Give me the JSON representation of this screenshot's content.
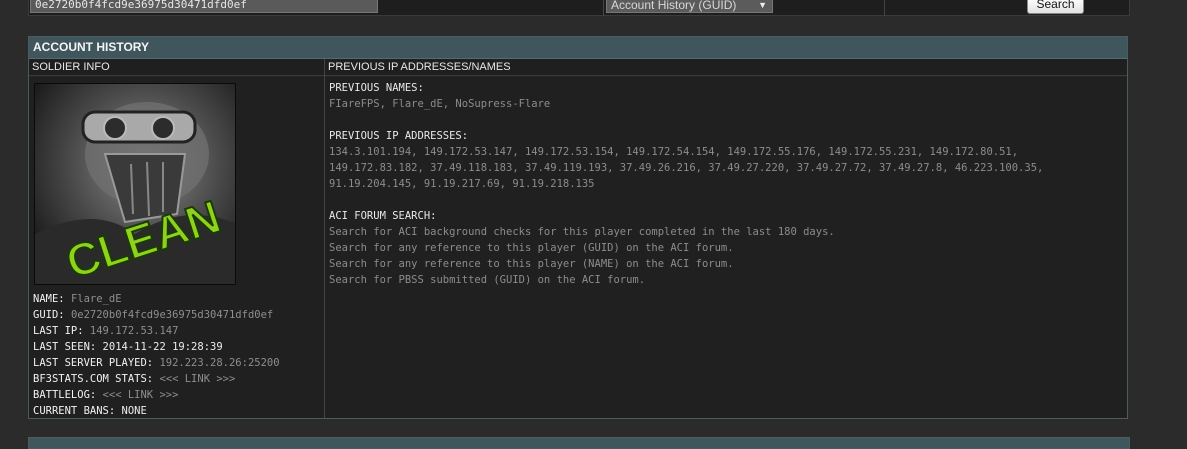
{
  "search": {
    "query_value": "0e2720b0f4fcd9e36975d30471dfd0ef",
    "type_selected": "Account History (GUID)",
    "button_label": "Search"
  },
  "panel": {
    "title": "ACCOUNT HISTORY",
    "left_header": "SOLDIER INFO",
    "right_header": "PREVIOUS IP ADDRESSES/NAMES"
  },
  "avatar": {
    "text": "CLEAN",
    "accent_color": "#8fd11c"
  },
  "soldier": {
    "name_label": "NAME:",
    "name": "Flare_dE",
    "guid_label": "GUID:",
    "guid": "0e2720b0f4fcd9e36975d30471dfd0ef",
    "last_ip_label": "LAST IP:",
    "last_ip": "149.172.53.147",
    "last_seen_label": "LAST SEEN:",
    "last_seen": "2014-11-22 19:28:39",
    "last_server_label": "LAST SERVER PLAYED:",
    "last_server": "192.223.28.26:25200",
    "bf3stats_label": "BF3STATS.COM STATS:",
    "bf3stats_link": "<<< LINK >>>",
    "battlelog_label": "BATTLELOG:",
    "battlelog_link": "<<< LINK >>>",
    "bans_label": "CURRENT BANS:",
    "bans": "NONE"
  },
  "history": {
    "names_heading": "PREVIOUS NAMES:",
    "names": "FIareFPS, Flare_dE, NoSupress-Flare",
    "ips_heading": "PREVIOUS IP ADDRESSES:",
    "ips_line1": "134.3.101.194, 149.172.53.147, 149.172.53.154, 149.172.54.154, 149.172.55.176, 149.172.55.231, 149.172.80.51,",
    "ips_line2": "149.172.83.182, 37.49.118.183, 37.49.119.193, 37.49.26.216, 37.49.27.220, 37.49.27.72, 37.49.27.8, 46.223.100.35,",
    "ips_line3": "91.19.204.145, 91.19.217.69, 91.19.218.135",
    "forum_heading": "ACI FORUM SEARCH:",
    "forum_links": [
      "Search for ACI background checks for this player completed in the last 180 days.",
      "Search for any reference to this player (GUID) on the ACI forum.",
      "Search for any reference to this player (NAME) on the ACI forum.",
      "Search for PBSS submitted (GUID) on the ACI forum."
    ]
  }
}
